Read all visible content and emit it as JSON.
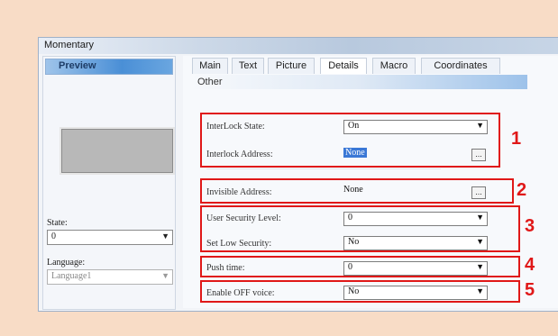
{
  "window": {
    "title": "Momentary"
  },
  "left": {
    "preview_label": "Preview",
    "state_label": "State:",
    "state_value": "0",
    "language_label": "Language:",
    "language_value": "Language1"
  },
  "tabs": [
    {
      "label": "Main"
    },
    {
      "label": "Text"
    },
    {
      "label": "Picture"
    },
    {
      "label": "Details",
      "active": true
    },
    {
      "label": "Macro"
    },
    {
      "label": "Coordinates"
    }
  ],
  "section": {
    "title": "Other"
  },
  "fields": {
    "interlock_state": {
      "label": "InterLock State:",
      "value": "On"
    },
    "interlock_address": {
      "label": "Interlock Address:",
      "value": "None",
      "button": "..."
    },
    "invisible_address": {
      "label": "Invisible Address:",
      "value": "None",
      "button": "..."
    },
    "user_security_level": {
      "label": "User Security Level:",
      "value": "0"
    },
    "set_low_security": {
      "label": "Set Low Security:",
      "value": "No"
    },
    "push_time": {
      "label": "Push time:",
      "value": "0"
    },
    "enable_off_voice": {
      "label": "Enable OFF voice:",
      "value": "No"
    }
  },
  "callouts": [
    "1",
    "2",
    "3",
    "4",
    "5"
  ],
  "colors": {
    "callout": "#e01818",
    "background": "#f8dcc6",
    "active_tab_header": "#4a8fd6"
  }
}
